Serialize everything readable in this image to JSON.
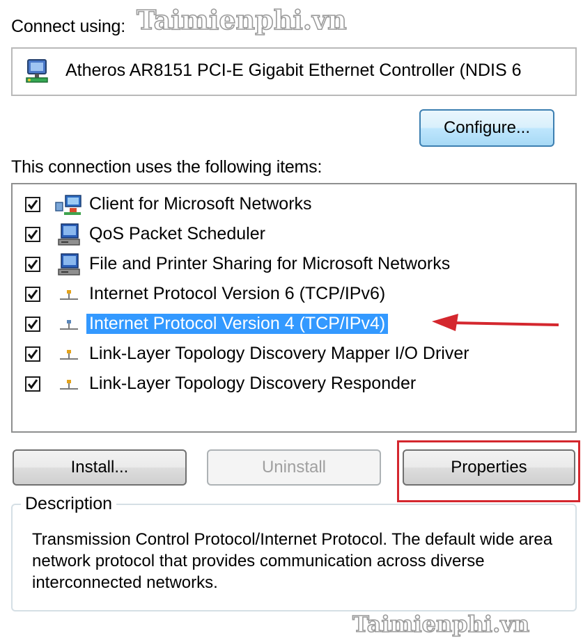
{
  "connect_using_label": "Connect using:",
  "adapter": {
    "name": "Atheros AR8151 PCI-E Gigabit Ethernet Controller (NDIS 6",
    "icon": "network-adapter-icon"
  },
  "buttons": {
    "configure": "Configure...",
    "install": "Install...",
    "uninstall": "Uninstall",
    "properties": "Properties"
  },
  "items_label": "This connection uses the following items:",
  "items": [
    {
      "label": "Client for Microsoft Networks",
      "checked": true,
      "icon": "client-network-icon",
      "selected": false
    },
    {
      "label": "QoS Packet Scheduler",
      "checked": true,
      "icon": "computer-icon",
      "selected": false
    },
    {
      "label": "File and Printer Sharing for Microsoft Networks",
      "checked": true,
      "icon": "computer-icon",
      "selected": false
    },
    {
      "label": "Internet Protocol Version 6 (TCP/IPv6)",
      "checked": true,
      "icon": "protocol-icon",
      "selected": false
    },
    {
      "label": "Internet Protocol Version 4 (TCP/IPv4)",
      "checked": true,
      "icon": "protocol-icon",
      "selected": true
    },
    {
      "label": "Link-Layer Topology Discovery Mapper I/O Driver",
      "checked": true,
      "icon": "protocol-icon",
      "selected": false
    },
    {
      "label": "Link-Layer Topology Discovery Responder",
      "checked": true,
      "icon": "protocol-icon",
      "selected": false
    }
  ],
  "description": {
    "legend": "Description",
    "text": "Transmission Control Protocol/Internet Protocol. The default wide area network protocol that provides communication across diverse interconnected networks."
  },
  "watermark": "Taimienphi.vn",
  "colors": {
    "selection": "#3399ff",
    "highlight": "#d4272e",
    "arrow": "#d4272e"
  }
}
